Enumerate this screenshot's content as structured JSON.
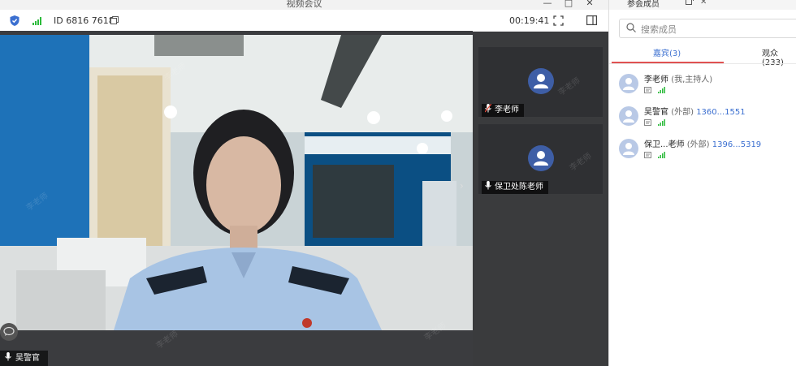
{
  "window": {
    "title": "视频会议",
    "controls": [
      "—",
      "□",
      "✕"
    ]
  },
  "toolbar": {
    "meeting_id": "ID 6816 7618",
    "timer": "00:19:41"
  },
  "main_speaker": {
    "name": "吴警官"
  },
  "watermark": "李老师",
  "thumbnails": [
    {
      "name": "李老师",
      "mic": "muted"
    },
    {
      "name": "保卫处陈老师",
      "mic": "on"
    }
  ],
  "panel": {
    "title": "参会成员",
    "search_placeholder": "搜索成员",
    "tabs": [
      {
        "label": "嘉宾(3)",
        "active": true
      },
      {
        "label": "观众(233)",
        "active": false
      }
    ],
    "members": [
      {
        "name": "李老师",
        "role": "(我,主持人)",
        "phone": ""
      },
      {
        "name": "吴警官",
        "role": "(外部)",
        "phone": "1360...1551"
      },
      {
        "name": "保卫...老师",
        "role": "(外部)",
        "phone": "1396...5319"
      }
    ]
  },
  "colors": {
    "accent": "#3b6fd0",
    "tab_underline": "#e05252",
    "avatar": "#3e5ea6",
    "signal": "#2dbb3c"
  }
}
